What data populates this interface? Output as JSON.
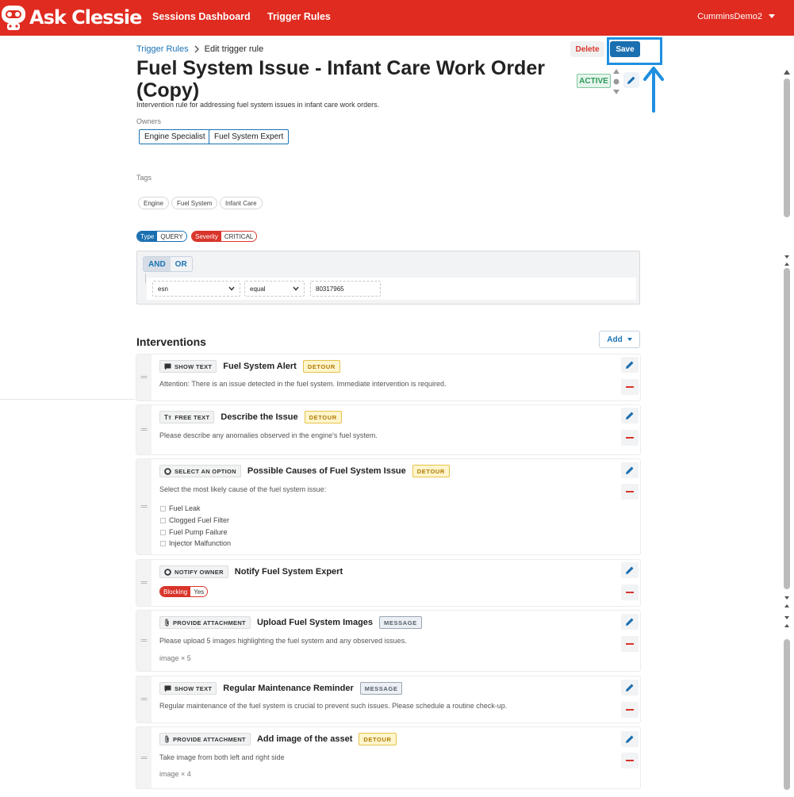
{
  "app": {
    "brand": "Ask Clessie",
    "nav": [
      "Sessions Dashboard",
      "Trigger Rules"
    ],
    "user": "CumminsDemo2"
  },
  "breadcrumb": {
    "parent": "Trigger Rules",
    "current": "Edit trigger rule"
  },
  "actions": {
    "delete_label": "Delete",
    "save_label": "Save"
  },
  "rule": {
    "title": "Fuel System Issue - Infant Care Work Order (Copy)",
    "status": "ACTIVE",
    "description": "Intervention rule for addressing fuel system issues in infant care work orders.",
    "owners_label": "Owners",
    "owners": [
      "Engine Specialist",
      "Fuel System Expert"
    ],
    "tags_label": "Tags",
    "tags": [
      "Engine",
      "Fuel System",
      "Infant Care"
    ],
    "type_key": "Type",
    "type_value": "QUERY",
    "severity_key": "Severity",
    "severity_value": "CRITICAL"
  },
  "query": {
    "and_label": "AND",
    "or_label": "OR",
    "field": "esn",
    "operator": "equal",
    "value": "80317965"
  },
  "interventions": {
    "title": "Interventions",
    "add_label": "Add",
    "items": [
      {
        "type": "SHOW TEXT",
        "title": "Fuel System Alert",
        "badge": "DETOUR",
        "text": "Attention: There is an issue detected in the fuel system. Immediate intervention is required."
      },
      {
        "type": "FREE TEXT",
        "title": "Describe the Issue",
        "badge": "DETOUR",
        "text": "Please describe any anomalies observed in the engine's fuel system."
      },
      {
        "type": "SELECT AN OPTION",
        "title": "Possible Causes of Fuel System Issue",
        "badge": "DETOUR",
        "text": "Select the most likely cause of the fuel system issue:",
        "options": [
          "Fuel Leak",
          "Clogged Fuel Filter",
          "Fuel Pump Failure",
          "Injector Malfunction"
        ]
      },
      {
        "type": "NOTIFY OWNER",
        "title": "Notify Fuel System Expert",
        "blocking_key": "Blocking",
        "blocking_value": "Yes"
      },
      {
        "type": "PROVIDE ATTACHMENT",
        "title": "Upload Fuel System Images",
        "badge": "MESSAGE",
        "text": "Please upload 5 images highlighting the fuel system and any observed issues.",
        "meta": "image × 5"
      },
      {
        "type": "SHOW TEXT",
        "title": "Regular Maintenance Reminder",
        "badge": "MESSAGE",
        "text": "Regular maintenance of the fuel system is crucial to prevent such issues. Please schedule a routine check-up."
      },
      {
        "type": "PROVIDE ATTACHMENT",
        "title": "Add image of the asset",
        "badge": "DETOUR",
        "text": "Take image from both left and right side",
        "meta": "image × 4"
      }
    ]
  },
  "colors": {
    "topbar": "#e02b20",
    "primary": "#1a6fb0",
    "danger": "#d9342b",
    "active": "#2b9a5b",
    "detour": "#e6c24a",
    "highlight": "#1e8fe0"
  }
}
